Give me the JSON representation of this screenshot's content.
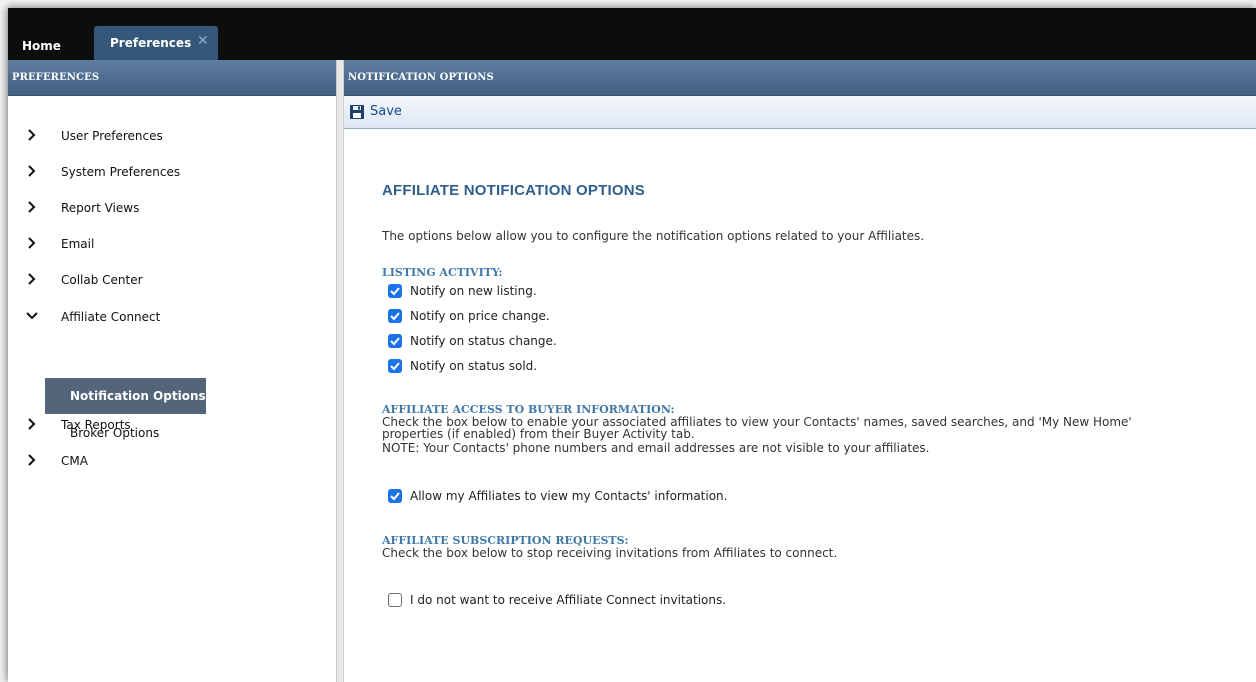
{
  "tabs": {
    "home_label": "Home",
    "preferences_label": "Preferences",
    "close_icon": "close-icon"
  },
  "sidebar": {
    "header": "PREFERENCES",
    "items": [
      {
        "label": "User Preferences",
        "icon": "chevron-right-icon"
      },
      {
        "label": "System Preferences",
        "icon": "chevron-right-icon"
      },
      {
        "label": "Report Views",
        "icon": "chevron-right-icon"
      },
      {
        "label": "Email",
        "icon": "chevron-right-icon"
      },
      {
        "label": "Collab Center",
        "icon": "chevron-right-icon"
      },
      {
        "label": "Affiliate Connect",
        "icon": "chevron-down-icon"
      },
      {
        "label": "Tax Reports",
        "icon": "chevron-right-icon"
      },
      {
        "label": "CMA",
        "icon": "chevron-right-icon"
      }
    ],
    "subitems": [
      {
        "label": "Notification Options",
        "active": true
      },
      {
        "label": "Broker Options",
        "active": false
      }
    ]
  },
  "main": {
    "header": "NOTIFICATION OPTIONS",
    "toolbar": {
      "save_label": "Save",
      "save_icon": "floppy-disk-icon"
    },
    "title": "AFFILIATE NOTIFICATION OPTIONS",
    "intro": "The options below allow you to configure the notification options related to your Affiliates.",
    "listing_activity": {
      "heading": "LISTING ACTIVITY:",
      "options": [
        {
          "label": "Notify on new listing.",
          "checked": true
        },
        {
          "label": "Notify on price change.",
          "checked": true
        },
        {
          "label": "Notify on status change.",
          "checked": true
        },
        {
          "label": "Notify on status sold.",
          "checked": true
        }
      ]
    },
    "buyer_access": {
      "heading": "AFFILIATE ACCESS TO BUYER INFORMATION:",
      "desc_line1": "Check the box below to enable your associated affiliates to view your Contacts' names, saved searches, and 'My New Home'",
      "desc_line2": "properties (if enabled) from their Buyer Activity tab.",
      "desc_line3": "NOTE: Your Contacts' phone numbers and email addresses are not visible to your affiliates.",
      "option": {
        "label": "Allow my Affiliates to view my Contacts' information.",
        "checked": true
      }
    },
    "subscription": {
      "heading": "AFFILIATE SUBSCRIPTION REQUESTS:",
      "desc": "Check the box below to stop receiving invitations from Affiliates to connect.",
      "option": {
        "label": "I do not want to receive Affiliate Connect invitations.",
        "checked": false
      }
    }
  },
  "colors": {
    "topbar": "#0d0d0d",
    "active_tab": "#34577a",
    "panel_header": "#4d6c8e",
    "active_subitem": "#536579",
    "title": "#2e5f8c",
    "section_heading": "#3f78a8",
    "checkbox_checked": "#1a73e8"
  }
}
